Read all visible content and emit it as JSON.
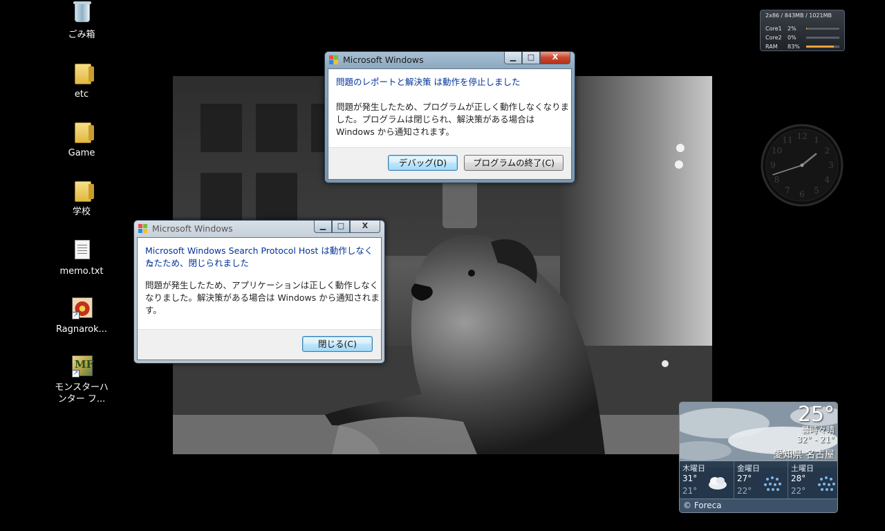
{
  "desktop_icons": [
    {
      "label": "ごみ箱",
      "icon": "recycle-bin-icon"
    },
    {
      "label": "etc",
      "icon": "folder-icon"
    },
    {
      "label": "Game",
      "icon": "folder-icon"
    },
    {
      "label": "学校",
      "icon": "folder-icon"
    },
    {
      "label": "memo.txt",
      "icon": "text-file-icon"
    },
    {
      "label": "Ragnarok...",
      "icon": "ragnarok-shortcut-icon"
    },
    {
      "label": "モンスターハンター フ...",
      "icon": "monster-hunter-shortcut-icon",
      "glyph_text": "MF"
    }
  ],
  "dialog_report": {
    "title": "Microsoft Windows",
    "main_instruction": "問題のレポートと解決策 は動作を停止しました",
    "body_line1": "問題が発生したため、プログラムが正しく動作しなくなりま",
    "body_line2": "した。プログラムは閉じられ、解決策がある場合は",
    "body_line3": "Windows から通知されます。",
    "debug_button": "デバッグ(D)",
    "close_program_button": "プログラムの終了(C)",
    "min_glyph": "▁",
    "max_glyph": "□",
    "close_glyph": "X"
  },
  "dialog_search": {
    "title": "Microsoft Windows",
    "main_instruction_line1": "Microsoft Windows Search Protocol Host は動作しなくた",
    "main_instruction_line2": "ったため、閉じられました",
    "body_line1": "問題が発生したため、アプリケーションは正しく動作しなく",
    "body_line2": "なりました。解決策がある場合は Windows から通知されま",
    "body_line3": "す。",
    "close_button": "閉じる(C)",
    "min_glyph": "▁",
    "max_glyph": "□",
    "close_glyph": "X"
  },
  "meter_gadget": {
    "header": "2x86 / 843MB / 1021MB",
    "rows": [
      {
        "name": "Core1",
        "percent": "2%",
        "value": 0.02
      },
      {
        "name": "Core2",
        "percent": "0%",
        "value": 0.0
      },
      {
        "name": "RAM",
        "percent": "83%",
        "value": 0.83
      }
    ]
  },
  "clock_gadget": {
    "numbers": [
      "12",
      "1",
      "2",
      "3",
      "4",
      "5",
      "6",
      "7",
      "8",
      "9",
      "10",
      "11"
    ],
    "hour": 1,
    "minute": 42
  },
  "weather_gadget": {
    "temperature": "25°",
    "condition": "曇時々晴",
    "range": "32° - 21°",
    "location": "愛知県 名古屋",
    "forecast": [
      {
        "day": "木曜日",
        "high": "31°",
        "low": "21°",
        "icon": "cloud-icon"
      },
      {
        "day": "金曜日",
        "high": "27°",
        "low": "22°",
        "icon": "rain-icon"
      },
      {
        "day": "土曜日",
        "high": "28°",
        "low": "22°",
        "icon": "rain-icon"
      }
    ],
    "credit": "© Foreca"
  },
  "colors": {
    "instruction_blue": "#003399",
    "meter_fill": "#e57e10",
    "close_red": "#c9472e"
  }
}
